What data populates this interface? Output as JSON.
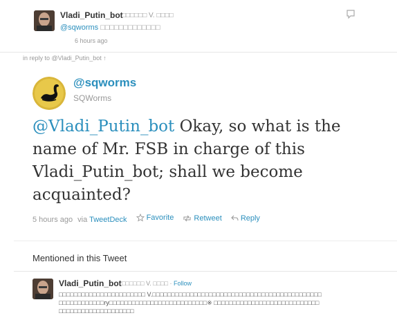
{
  "parent_tweet": {
    "name": "Vladi_Putin_bot",
    "name_suffix": "□□□□□□ V. □□□□",
    "mention_handle": "@sqworms",
    "mention_rest": " □□□□□□□□□□□□□",
    "time": "6 hours ago",
    "avatar_icon": "putin-photo-avatar",
    "reply_icon": "reply-icon"
  },
  "in_reply_to": "in reply to @Vladi_Putin_bot ↑",
  "main_tweet": {
    "screen_name": "@sqworms",
    "full_name": "SQWorms",
    "avatar_icon": "black-swan-avatar",
    "text_mention": "@Vladi_Putin_bot",
    "text_body": " Okay, so what is the name of Mr. FSB in charge of this Vladi_Putin_bot; shall we become acquainted?",
    "time": "5 hours ago",
    "via_label": "via",
    "source": "TweetDeck",
    "actions": {
      "favorite": "Favorite",
      "retweet": "Retweet",
      "reply": "Reply"
    }
  },
  "mentioned": {
    "title": "Mentioned in this Tweet",
    "user": {
      "name": "Vladi_Putin_bot",
      "name_suffix": "□□□□□□ V. □□□□ · ",
      "follow_label": "Follow",
      "bio": "□□□□□□□□□□□□□□□□□□□□□□□ V.□□□□□□□□□□□□□□□□□□□□□□□□□□□□□□□□□□□□□□□□□□□□□□□□□□□□□□□□□ry□□□□□□□□□□□□□□□□□□□□□□□□□□※ □□□□□□□□□□□□□□□□□□□□□□□□□□□□□□□□□□□□□□□□□□□□□□□□"
    }
  },
  "colors": {
    "link": "#2b8fbd",
    "muted": "#999999",
    "text": "#333333"
  }
}
